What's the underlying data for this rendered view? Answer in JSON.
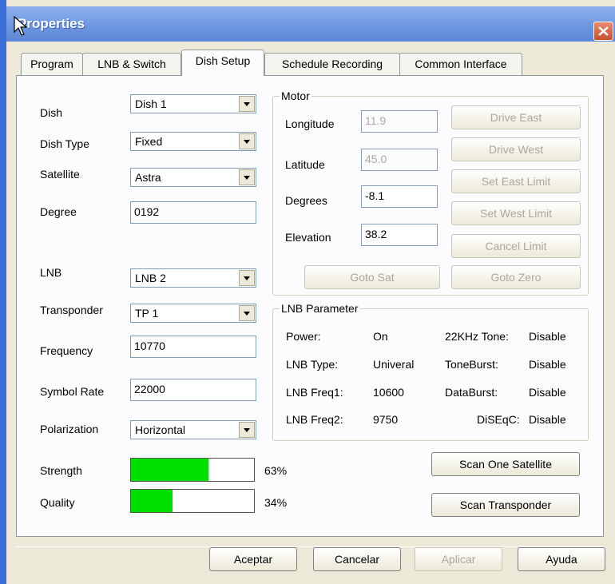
{
  "window": {
    "title": "Properties"
  },
  "tabs": [
    "Program",
    "LNB & Switch",
    "Dish Setup",
    "Schedule Recording",
    "Common Interface"
  ],
  "dish": {
    "dish_label": "Dish",
    "dish_value": "Dish 1",
    "dish_type_label": "Dish Type",
    "dish_type_value": "Fixed",
    "satellite_label": "Satellite",
    "satellite_value": "Astra",
    "degree_label": "Degree",
    "degree_value": "0192",
    "lnb_label": "LNB",
    "lnb_value": "LNB 2",
    "transponder_label": "Transponder",
    "transponder_value": "TP 1",
    "frequency_label": "Frequency",
    "frequency_value": "10770",
    "symbol_rate_label": "Symbol Rate",
    "symbol_rate_value": "22000",
    "polarization_label": "Polarization",
    "polarization_value": "Horizontal"
  },
  "motor": {
    "title": "Motor",
    "longitude_label": "Longitude",
    "longitude_value": "11.9",
    "latitude_label": "Latitude",
    "latitude_value": "45.0",
    "degrees_label": "Degrees",
    "degrees_value": "-8.1",
    "elevation_label": "Elevation",
    "elevation_value": "38.2",
    "buttons": {
      "drive_east": "Drive East",
      "drive_west": "Drive West",
      "set_east_limit": "Set East Limit",
      "set_west_limit": "Set West Limit",
      "cancel_limit": "Cancel Limit",
      "goto_sat": "Goto Sat",
      "goto_zero": "Goto Zero"
    }
  },
  "lnb_param": {
    "title": "LNB Parameter",
    "power_label": "Power:",
    "power_value": "On",
    "lnb_type_label": "LNB Type:",
    "lnb_type_value": "Univeral",
    "lnb_freq1_label": "LNB Freq1:",
    "lnb_freq1_value": "10600",
    "lnb_freq2_label": "LNB Freq2:",
    "lnb_freq2_value": "9750",
    "tone22_label": "22KHz Tone:",
    "tone22_value": "Disable",
    "toneburst_label": "ToneBurst:",
    "toneburst_value": "Disable",
    "databurst_label": "DataBurst:",
    "databurst_value": "Disable",
    "diseqc_label": "DiSEqC:",
    "diseqc_value": "Disable"
  },
  "signal": {
    "strength_label": "Strength",
    "strength_pct": 63,
    "strength_text": "63%",
    "quality_label": "Quality",
    "quality_pct": 34,
    "quality_text": "34%",
    "fill_color": "#00e000"
  },
  "scan": {
    "one_satellite": "Scan One Satellite",
    "transponder": "Scan Transponder"
  },
  "footer": {
    "ok": "Aceptar",
    "cancel": "Cancelar",
    "apply": "Aplicar",
    "help": "Ayuda"
  }
}
